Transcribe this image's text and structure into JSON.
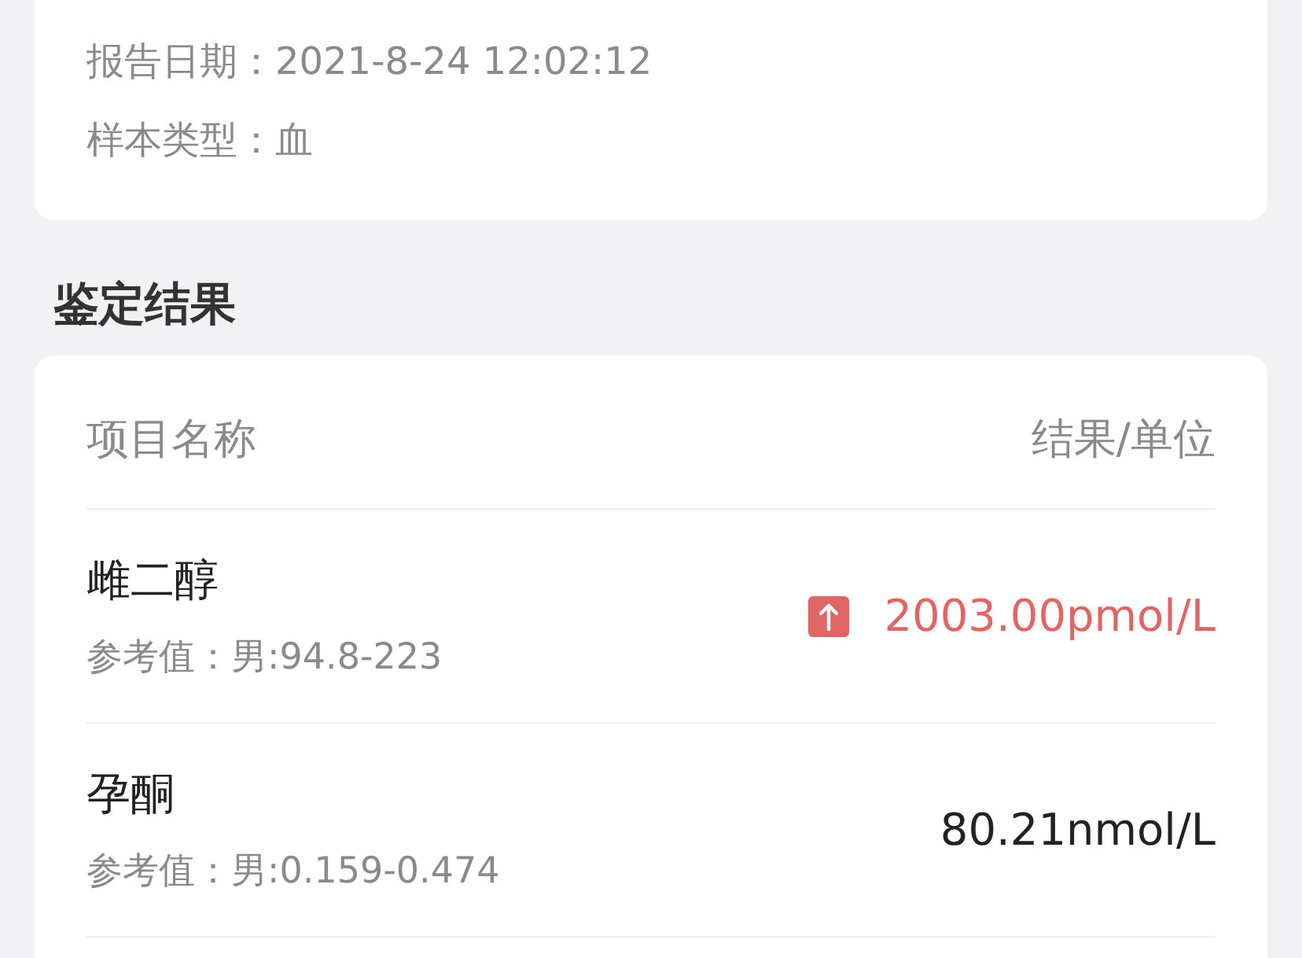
{
  "sample_info": {
    "fields": [
      {
        "label": "报告日期：",
        "value": "2021-8-24 12:02:12"
      },
      {
        "label": "样本类型：",
        "value": "血"
      }
    ]
  },
  "results": {
    "title": "鉴定结果",
    "columns": [
      "项目名称",
      "结果/单位"
    ],
    "rows": [
      {
        "name": "雌二醇",
        "reference": "参考值：男:94.8-223",
        "result": "2003.00pmol/L",
        "above_range": true
      },
      {
        "name": "孕酮",
        "reference": "参考值：男:0.159-0.474",
        "result": "80.21nmol/L",
        "above_range": false
      }
    ]
  }
}
